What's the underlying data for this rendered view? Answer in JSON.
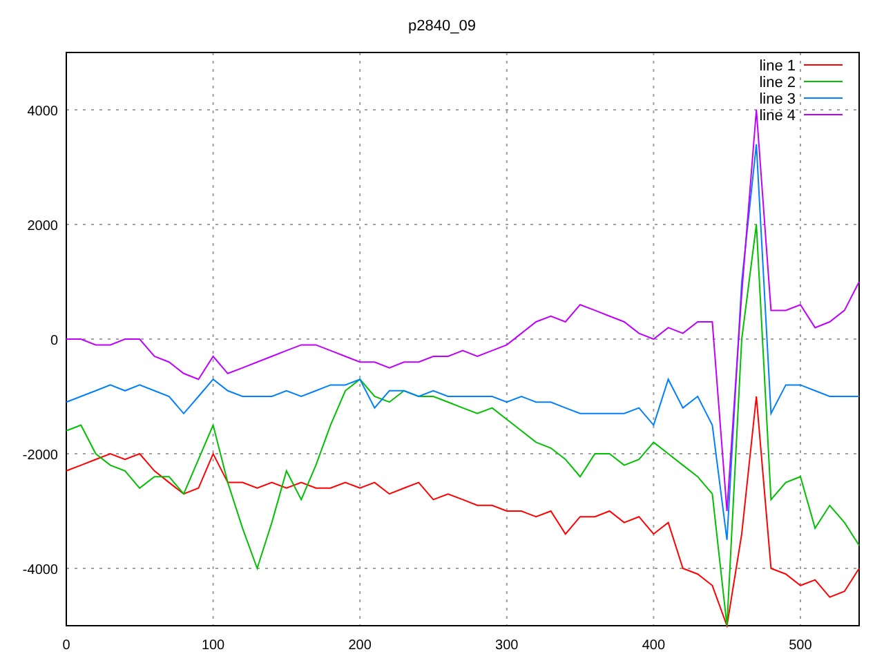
{
  "chart_data": {
    "type": "line",
    "title": "p2840_09",
    "x": [
      0,
      10,
      20,
      30,
      40,
      50,
      60,
      70,
      80,
      90,
      100,
      110,
      120,
      130,
      140,
      150,
      160,
      170,
      180,
      190,
      200,
      210,
      220,
      230,
      240,
      250,
      260,
      270,
      280,
      290,
      300,
      310,
      320,
      330,
      340,
      350,
      360,
      370,
      380,
      390,
      400,
      410,
      420,
      430,
      440,
      450,
      460,
      470,
      480,
      490,
      500,
      510,
      520,
      530,
      540
    ],
    "series": [
      {
        "name": "line 1",
        "color": "#ff0000",
        "values": [
          -2300,
          -2200,
          -2100,
          -2000,
          -2100,
          -2000,
          -2300,
          -2500,
          -2700,
          -2600,
          -2000,
          -2500,
          -2500,
          -2600,
          -2500,
          -2600,
          -2500,
          -2600,
          -2600,
          -2500,
          -2600,
          -2500,
          -2700,
          -2600,
          -2500,
          -2800,
          -2700,
          -2800,
          -2900,
          -2900,
          -3000,
          -3000,
          -3100,
          -3000,
          -3400,
          -3100,
          -3100,
          -3000,
          -3200,
          -3100,
          -3400,
          -3200,
          -4000,
          -4100,
          -4300,
          -5000,
          -3400,
          -1000,
          -4000,
          -4100,
          -4300,
          -4200,
          -4500,
          -4400,
          -4000
        ]
      },
      {
        "name": "line 2",
        "color": "#00c000",
        "values": [
          -1600,
          -1500,
          -2000,
          -2200,
          -2300,
          -2600,
          -2400,
          -2400,
          -2700,
          -2100,
          -1500,
          -2500,
          -3300,
          -4000,
          -3200,
          -2300,
          -2800,
          -2200,
          -1500,
          -900,
          -700,
          -1000,
          -1100,
          -900,
          -1000,
          -1000,
          -1100,
          -1200,
          -1300,
          -1200,
          -1400,
          -1600,
          -1800,
          -1900,
          -2100,
          -2400,
          -2000,
          -2000,
          -2200,
          -2100,
          -1800,
          -2000,
          -2200,
          -2400,
          -2700,
          -5000,
          0,
          2000,
          -2800,
          -2500,
          -2400,
          -3300,
          -2900,
          -3200,
          -3600
        ]
      },
      {
        "name": "line 3",
        "color": "#0080ff",
        "values": [
          -1100,
          -1000,
          -900,
          -800,
          -900,
          -800,
          -900,
          -1000,
          -1300,
          -1000,
          -700,
          -900,
          -1000,
          -1000,
          -1000,
          -900,
          -1000,
          -900,
          -800,
          -800,
          -700,
          -1200,
          -900,
          -900,
          -1000,
          -900,
          -1000,
          -1000,
          -1000,
          -1000,
          -1100,
          -1000,
          -1100,
          -1100,
          -1200,
          -1300,
          -1300,
          -1300,
          -1300,
          -1200,
          -1500,
          -700,
          -1200,
          -1000,
          -1500,
          -3500,
          1000,
          3400,
          -1300,
          -800,
          -800,
          -900,
          -1000,
          -1000,
          -1000
        ]
      },
      {
        "name": "line 4",
        "color": "#c000ff",
        "values": [
          0,
          0,
          -100,
          -100,
          0,
          0,
          -300,
          -400,
          -600,
          -700,
          -300,
          -600,
          -500,
          -400,
          -300,
          -200,
          -100,
          -100,
          -200,
          -300,
          -400,
          -400,
          -500,
          -400,
          -400,
          -300,
          -300,
          -200,
          -300,
          -200,
          -100,
          100,
          300,
          400,
          300,
          600,
          500,
          400,
          300,
          100,
          0,
          200,
          100,
          300,
          300,
          -3000,
          800,
          4000,
          500,
          500,
          600,
          200,
          300,
          500,
          1000
        ]
      }
    ],
    "xlim": [
      0,
      540
    ],
    "ylim": [
      -5000,
      5000
    ],
    "xticks": [
      0,
      100,
      200,
      300,
      400,
      500
    ],
    "yticks": [
      -4000,
      -2000,
      0,
      2000,
      4000
    ],
    "grid": true,
    "legend": true
  }
}
